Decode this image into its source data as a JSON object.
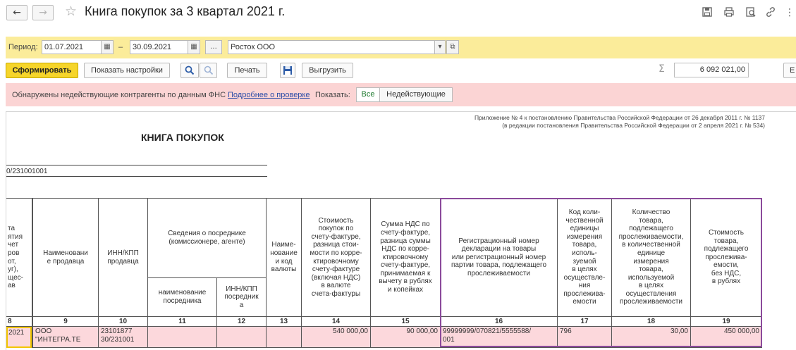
{
  "window": {
    "title": "Книга покупок за 3 квартал 2021 г.",
    "nav_back": "←",
    "nav_forward": "→",
    "favorite_icon": "star-icon",
    "icons": [
      "save-icon",
      "print-icon",
      "preview-icon",
      "link-icon",
      "more-icon"
    ]
  },
  "period_bar": {
    "period_label": "Период:",
    "date_from": "01.07.2021",
    "date_separator": "–",
    "date_to": "30.09.2021",
    "ellipsis_label": "...",
    "organization": "Росток ООО"
  },
  "toolbar": {
    "generate_label": "Сформировать",
    "settings_label": "Показать настройки",
    "print_label": "Печать",
    "export_label": "Выгрузить",
    "sum_symbol": "Σ",
    "sum_value": "6 092 021,00",
    "more_label": "Е"
  },
  "warning": {
    "message": "Обнаружены недействующие контрагенты по данным ФНС",
    "link": "Подробнее о проверке",
    "show_label": "Показать:",
    "filter_all": "Все",
    "filter_inactive": "Недействующие"
  },
  "report": {
    "appendix_line1": "Приложение № 4 к постановлению Правительства Российской Федерации от 26 декабря 2011 г. № 1137",
    "appendix_line2": "(в редакции постановления Правительства Российской Федерации от 2 апреля 2021 г. № 534)",
    "book_title": "КНИГА ПОКУПОК",
    "buyer_inn": "0/231001001"
  },
  "table": {
    "headers": {
      "c8": "та\nятия\nчет\nров\nот,\nуг),\nщес-\nав",
      "c9": "Наименовани\nе продавца",
      "c10": "ИНН/КПП\nпродавца",
      "c11_12": "Сведения о посреднике\n(комиссионере, агенте)",
      "c11": "наименование\nпосредника",
      "c12": "ИНН/КПП\nпосредник\nа",
      "c13": "Наиме-\nнование\nи код\nвалюты",
      "c14": "Стоимость\nпокупок по\nсчету-фактуре,\nразница стои-\nмости по корре-\nктировочному\nсчету-фактуре\n(включая НДС)\nв валюте\nсчета-фактуры",
      "c15": "Сумма НДС по\nсчету-фактуре,\nразница суммы\nНДС по корре-\nктировочному\nсчету-фактуре,\nпринимаемая к\nвычету в рублях\nи копейках",
      "c16": "Регистрационный номер\nдекларации на товары\nили регистрационный номер\nпартии товара, подлежащего\nпрослеживаемости",
      "c17": "Код коли-\nчественной\nединицы\nизмерения\nтовара,\nисполь-\nзуемой\nв целях\nосуществле-\nния\nпрослежива-\nемости",
      "c18": "Количество\nтовара,\nподлежащего\nпрослеживаемости,\nв количественной\nединице\nизмерения\nтовара,\nиспользуемой\nв целях\nосуществления\nпрослеживаемости",
      "c19": "Стоимость\nтовара,\nподлежащего\nпрослежива-\nемости,\nбез НДС,\nв рублях"
    },
    "numbers": {
      "c8": "8",
      "c9": "9",
      "c10": "10",
      "c11": "11",
      "c12": "12",
      "c13": "13",
      "c14": "14",
      "c15": "15",
      "c16": "16",
      "c17": "17",
      "c18": "18",
      "c19": "19"
    },
    "row": {
      "c8": "2021",
      "c9": "ООО\n\"ИНТЕГРА.ТЕ",
      "c10": "23101877\n30/231001",
      "c11": "",
      "c12": "",
      "c13": "",
      "c14": "540 000,00",
      "c15": "90 000,00",
      "c16": "99999999/070821/5555588/\n001",
      "c17": "796",
      "c18": "30,00",
      "c19": "450 000,00"
    }
  }
}
